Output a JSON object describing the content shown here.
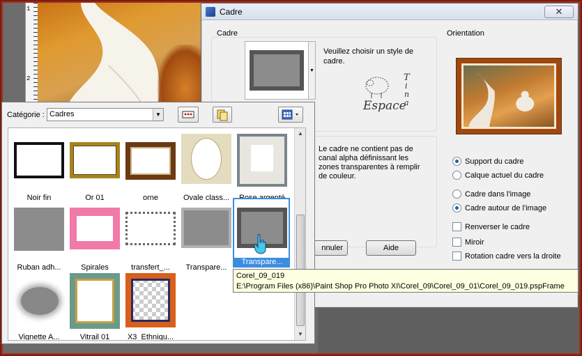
{
  "dialog": {
    "title": "Cadre",
    "close_symbol": "✕",
    "cadre_group_label": "Cadre",
    "orientation_group_label": "Orientation",
    "style_prompt": "Veuillez choisir un style de cadre.",
    "alpha_notice": "Le cadre ne contient pas de canal alpha définissant les zones transparentes à remplir de couleur.",
    "logo_text": "Espace",
    "logo_letters": [
      "T",
      "i",
      "n",
      "a"
    ],
    "radios": [
      {
        "label": "Support du cadre",
        "checked": true
      },
      {
        "label": "Calque actuel du cadre",
        "checked": false
      },
      {
        "label": "Cadre dans l'image",
        "checked": false
      },
      {
        "label": "Cadre autour de l'image",
        "checked": true
      }
    ],
    "checkboxes": [
      {
        "label": "Renverser le cadre",
        "checked": false
      },
      {
        "label": "Miroir",
        "checked": false
      },
      {
        "label": "Rotation cadre vers la droite",
        "checked": false
      }
    ],
    "cancel_label": "nnuler",
    "help_label": "Aide"
  },
  "palette": {
    "category_label": "Catégorie :",
    "category_value": "Cadres",
    "items": [
      {
        "label": "Noir fin",
        "style": "noir"
      },
      {
        "label": "Or 01",
        "style": "or"
      },
      {
        "label": "orne",
        "style": "orne"
      },
      {
        "label": "Ovale class...",
        "style": "ovale"
      },
      {
        "label": "Rose argenté",
        "style": "rose"
      },
      {
        "label": "Ruban adh...",
        "style": "ruban"
      },
      {
        "label": "Spirales",
        "style": "spirales"
      },
      {
        "label": "transfert_...",
        "style": "transfert"
      },
      {
        "label": "Transpare...",
        "style": "transp1"
      },
      {
        "label": "Transpare...",
        "style": "transp2",
        "selected": true
      },
      {
        "label": "Vignette A...",
        "style": "vignette"
      },
      {
        "label": "Vitrail 01",
        "style": "vitrail"
      },
      {
        "label": "X3_Ethniqu...",
        "style": "ethnique"
      }
    ]
  },
  "tooltip": {
    "name": "Corel_09_019",
    "path": "E:\\Program Files (x86)\\Paint Shop Pro Photo XI\\Corel_09\\Corel_09_01\\Corel_09_019.pspFrame"
  },
  "ruler": {
    "labels": [
      "1",
      "2"
    ]
  },
  "colors": {
    "accent": "#3c8de0",
    "frame_border": "#a03020",
    "tooltip_bg": "#ffffe1"
  }
}
